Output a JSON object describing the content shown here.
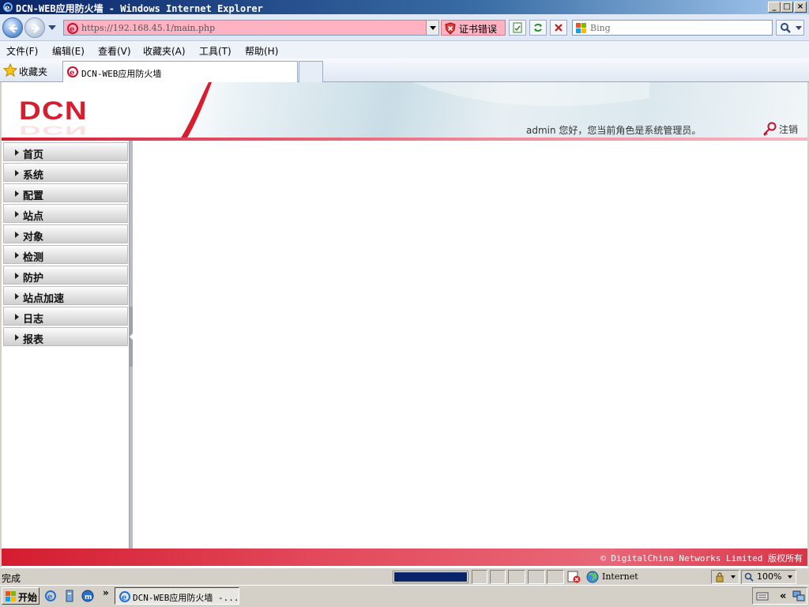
{
  "window": {
    "title": "DCN-WEB应用防火墙 - Windows Internet Explorer",
    "controls": [
      "_",
      "□",
      "×"
    ]
  },
  "browser": {
    "url": "https://192.168.45.1/main.php",
    "cert_error": "证书错误",
    "search_placeholder": "Bing",
    "menu": [
      "文件(F)",
      "编辑(E)",
      "查看(V)",
      "收藏夹(A)",
      "工具(T)",
      "帮助(H)"
    ],
    "favorites_label": "收藏夹",
    "tab_title": "DCN-WEB应用防火墙"
  },
  "app": {
    "logo": "DCN",
    "welcome": "admin 您好，您当前角色是系统管理员。",
    "logout": "注销",
    "nav": [
      "首页",
      "系统",
      "配置",
      "站点",
      "对象",
      "检测",
      "防护",
      "站点加速",
      "日志",
      "报表"
    ],
    "footer": "© DigitalChina Networks Limited 版权所有"
  },
  "statusbar": {
    "text": "完成",
    "progress": 1.0,
    "zone": "Internet",
    "zoom": "100%"
  },
  "taskbar": {
    "start": "开始",
    "chevron": "»",
    "task": "DCN-WEB应用防火墙 -..."
  },
  "colors": {
    "brand_red": "#d81e2e",
    "ie_blue": "#0a246a",
    "error_pink": "#ffb3c2"
  }
}
